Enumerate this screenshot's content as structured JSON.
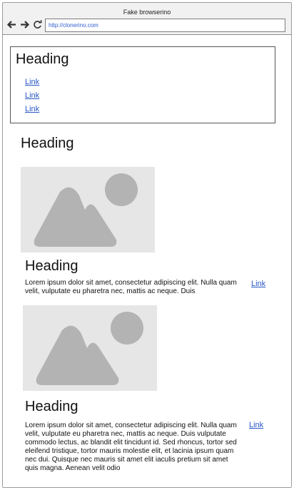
{
  "window": {
    "title": "Fake browserino",
    "address": "http://clonerino.com"
  },
  "nav": {
    "heading": "Heading",
    "links": [
      "Link",
      "Link",
      "Link"
    ]
  },
  "main": {
    "heading": "Heading",
    "cards": [
      {
        "heading": "Heading",
        "body": "Lorem ipsum dolor sit amet, consectetur adipiscing elit. Nulla quam velit, vulputate eu pharetra nec, mattis ac neque. Duis",
        "link": "Link"
      },
      {
        "heading": "Heading",
        "body": "Lorem ipsum dolor sit amet, consectetur adipiscing elit. Nulla quam velit, vulputate eu pharetra nec, mattis ac neque. Duis vulputate commodo lectus, ac blandit elit tincidunt id. Sed rhoncus, tortor sed eleifend tristique, tortor mauris molestie elit, et lacinia ipsum quam nec dui. Quisque nec mauris sit amet elit iaculis pretium sit amet quis magna. Aenean velit odio",
        "link": "Link"
      }
    ]
  },
  "colors": {
    "link": "#2858c4",
    "placeholder_bg": "#e6e6e6",
    "placeholder_shape": "#b3b3b3"
  }
}
